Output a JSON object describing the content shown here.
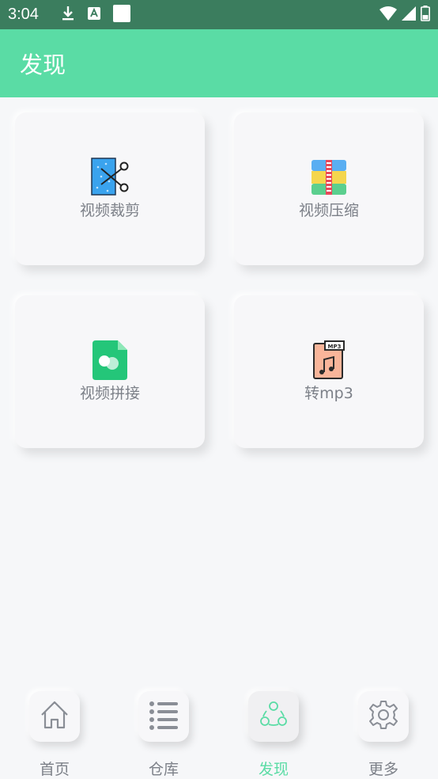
{
  "status_bar": {
    "time": "3:04",
    "icons": [
      "download-icon",
      "app-notification-icon",
      "blank-notification-icon",
      "wifi-icon",
      "signal-icon",
      "battery-icon"
    ]
  },
  "app_bar": {
    "title": "发现"
  },
  "cards": [
    {
      "label": "视频裁剪",
      "icon": "video-cut-icon"
    },
    {
      "label": "视频压缩",
      "icon": "video-compress-icon"
    },
    {
      "label": "视频拼接",
      "icon": "video-merge-icon"
    },
    {
      "label": "转mp3",
      "icon": "convert-mp3-icon"
    }
  ],
  "bottom_nav": [
    {
      "label": "首页",
      "icon": "home-icon",
      "active": false
    },
    {
      "label": "仓库",
      "icon": "list-icon",
      "active": false
    },
    {
      "label": "发现",
      "icon": "discover-icon",
      "active": true
    },
    {
      "label": "更多",
      "icon": "gear-icon",
      "active": false
    }
  ],
  "colors": {
    "accent": "#5adca5",
    "status_bar": "#3b7d5e",
    "background": "#f6f7f9",
    "label": "#7c8088"
  }
}
